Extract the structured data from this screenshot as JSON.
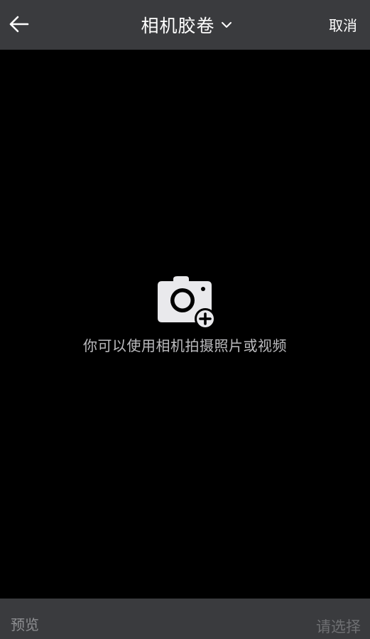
{
  "header": {
    "back_icon": "arrow-left-icon",
    "title": "相机胶卷",
    "dropdown_icon": "chevron-down-icon",
    "cancel_label": "取消"
  },
  "empty_state": {
    "icon": "camera-add-icon",
    "message": "你可以使用相机拍摄照片或视频"
  },
  "footer": {
    "preview_label": "预览",
    "select_label": "请选择"
  },
  "colors": {
    "bar_background": "#3a3b3e",
    "main_background": "#000000",
    "icon_color": "#e9e9ec",
    "message_color": "#bcbcbf",
    "disabled_text": "#6f7073"
  }
}
